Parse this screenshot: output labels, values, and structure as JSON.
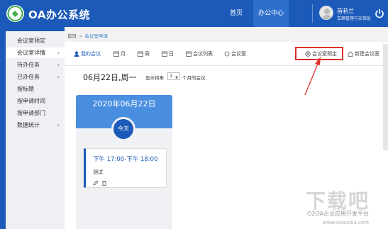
{
  "header": {
    "app_title": "OA办公系统",
    "nav": [
      "首页",
      "办公中心"
    ],
    "user_name": "苗若兰",
    "user_dept": "车辆管理与安保处"
  },
  "sidebar": {
    "items": [
      {
        "label": "会议室预定",
        "chevron": ""
      },
      {
        "label": "会议室详情",
        "chevron": "›"
      },
      {
        "label": "待办任务",
        "chevron": "›"
      },
      {
        "label": "已办任务",
        "chevron": "›"
      },
      {
        "label": "按标题",
        "chevron": ""
      },
      {
        "label": "按申请时间",
        "chevron": ""
      },
      {
        "label": "按申请部门",
        "chevron": ""
      },
      {
        "label": "数据统计",
        "chevron": "›"
      }
    ]
  },
  "breadcrumb": {
    "home": "首页",
    "separator": ">",
    "current": "会议室申请"
  },
  "toolbar": {
    "mine": "我的会议",
    "month": "月",
    "week": "周",
    "day": "日",
    "list": "会议列表",
    "room": "会议室",
    "booking": "会议室预定",
    "new_room": "新建会议室"
  },
  "date_row": {
    "date_title": "06月22日,周一",
    "show_label": "显示将来",
    "show_value": "1",
    "show_suffix": "个月的会议"
  },
  "calendar": {
    "day_header": "2020年06月22日",
    "today_label": "今天",
    "meeting": {
      "time": "下午 17:00-下午 18:00",
      "title": "测试"
    }
  },
  "watermark": {
    "big": "下载吧",
    "line1": "O2OA企业应用开发平台",
    "line2": "www.xiazaiba.com"
  },
  "colors": {
    "primary": "#1b5ab8",
    "header_day": "#4a8ee0",
    "highlight_red": "#e0302a"
  }
}
